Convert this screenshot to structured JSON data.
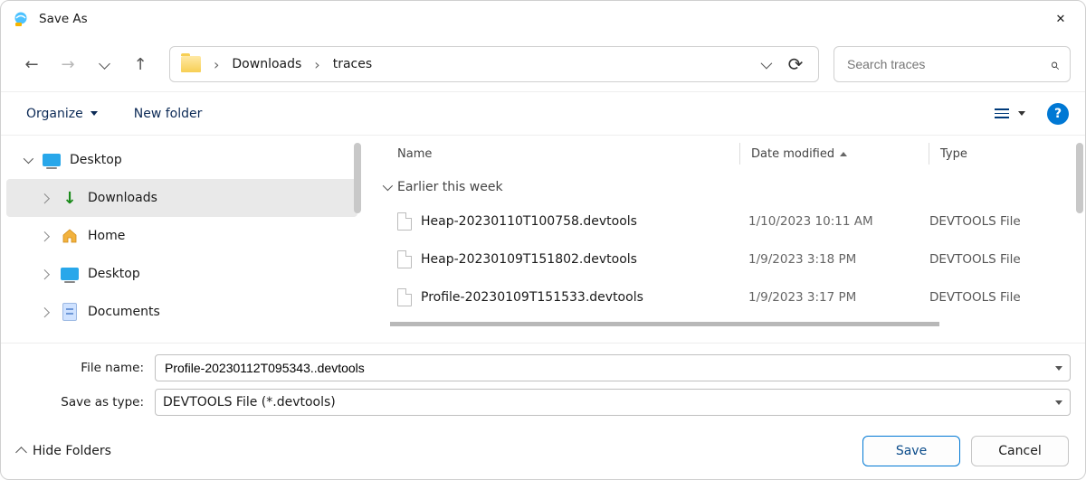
{
  "window": {
    "title": "Save As"
  },
  "breadcrumb": {
    "items": [
      "Downloads",
      "traces"
    ]
  },
  "search": {
    "placeholder": "Search traces"
  },
  "toolbar": {
    "organize": "Organize",
    "newfolder": "New folder"
  },
  "tree": {
    "items": [
      {
        "label": "Desktop",
        "icon": "desktop",
        "depth": 0,
        "expanded": true,
        "selected": false
      },
      {
        "label": "Downloads",
        "icon": "download",
        "depth": 1,
        "expanded": false,
        "selected": true
      },
      {
        "label": "Home",
        "icon": "home",
        "depth": 1,
        "expanded": false,
        "selected": false
      },
      {
        "label": "Desktop",
        "icon": "desktop",
        "depth": 1,
        "expanded": false,
        "selected": false
      },
      {
        "label": "Documents",
        "icon": "documents",
        "depth": 1,
        "expanded": false,
        "selected": false
      }
    ]
  },
  "columns": {
    "name": "Name",
    "modified": "Date modified",
    "type": "Type"
  },
  "group": {
    "label": "Earlier this week"
  },
  "files": [
    {
      "name": "Heap-20230110T100758.devtools",
      "modified": "1/10/2023 10:11 AM",
      "type": "DEVTOOLS File"
    },
    {
      "name": "Heap-20230109T151802.devtools",
      "modified": "1/9/2023 3:18 PM",
      "type": "DEVTOOLS File"
    },
    {
      "name": "Profile-20230109T151533.devtools",
      "modified": "1/9/2023 3:17 PM",
      "type": "DEVTOOLS File"
    }
  ],
  "fields": {
    "filename_label": "File name:",
    "filename_value": "Profile-20230112T095343..devtools",
    "savetype_label": "Save as type:",
    "savetype_value": "DEVTOOLS File (*.devtools)"
  },
  "footer": {
    "hide_folders": "Hide Folders",
    "save": "Save",
    "cancel": "Cancel"
  }
}
